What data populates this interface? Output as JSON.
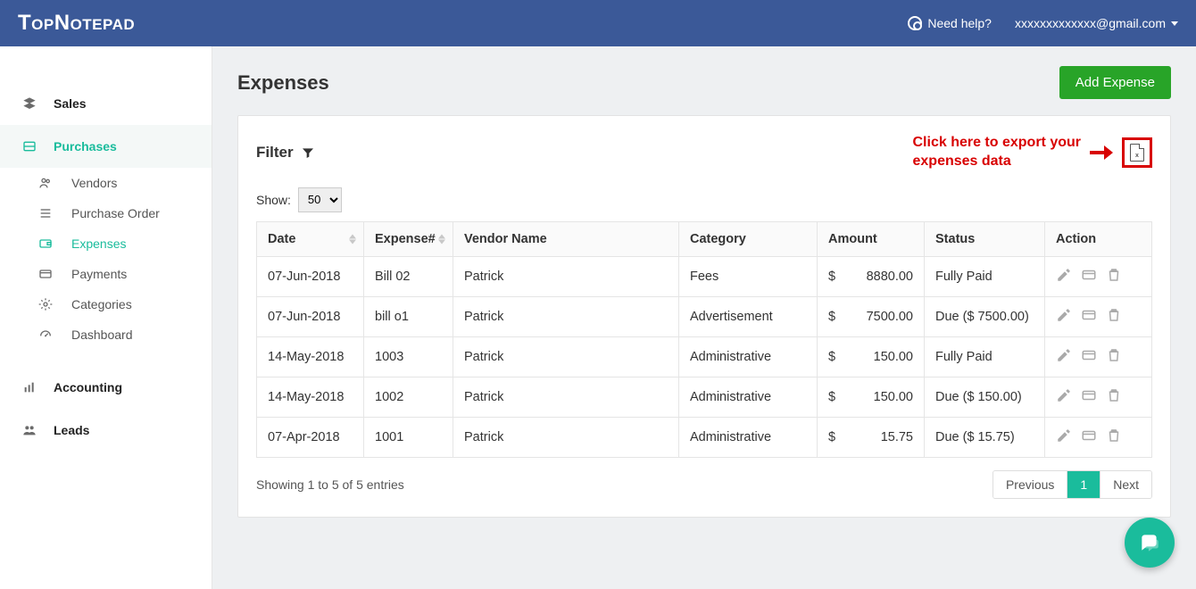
{
  "brand": "TopNotepad",
  "header": {
    "help_label": "Need help?",
    "user_email": "xxxxxxxxxxxxx@gmail.com"
  },
  "sidebar": {
    "sections": [
      {
        "label": "Sales",
        "icon": "layers-icon"
      },
      {
        "label": "Purchases",
        "icon": "folder-icon",
        "active": true
      },
      {
        "label": "Accounting",
        "icon": "chart-icon"
      },
      {
        "label": "Leads",
        "icon": "group-icon"
      }
    ],
    "purchases_sub": [
      {
        "label": "Vendors",
        "icon": "users-icon"
      },
      {
        "label": "Purchase Order",
        "icon": "list-icon"
      },
      {
        "label": "Expenses",
        "icon": "wallet-icon",
        "active": true
      },
      {
        "label": "Payments",
        "icon": "card-icon"
      },
      {
        "label": "Categories",
        "icon": "gear-icon"
      },
      {
        "label": "Dashboard",
        "icon": "gauge-icon"
      }
    ]
  },
  "page": {
    "title": "Expenses",
    "add_button": "Add Expense",
    "filter_label": "Filter",
    "callout_line1": "Click here to export your",
    "callout_line2": "expenses data",
    "show_label": "Show:",
    "show_value": "50",
    "table": {
      "headers": [
        "Date",
        "Expense#",
        "Vendor Name",
        "Category",
        "Amount",
        "Status",
        "Action"
      ],
      "rows": [
        {
          "date": "07-Jun-2018",
          "num": "Bill 02",
          "vendor": "Patrick",
          "category": "Fees",
          "cur": "$",
          "amount": "8880.00",
          "status": "Fully Paid"
        },
        {
          "date": "07-Jun-2018",
          "num": "bill o1",
          "vendor": "Patrick",
          "category": "Advertisement",
          "cur": "$",
          "amount": "7500.00",
          "status": "Due ($ 7500.00)"
        },
        {
          "date": "14-May-2018",
          "num": "1003",
          "vendor": "Patrick",
          "category": "Administrative",
          "cur": "$",
          "amount": "150.00",
          "status": "Fully Paid"
        },
        {
          "date": "14-May-2018",
          "num": "1002",
          "vendor": "Patrick",
          "category": "Administrative",
          "cur": "$",
          "amount": "150.00",
          "status": "Due ($ 150.00)"
        },
        {
          "date": "07-Apr-2018",
          "num": "1001",
          "vendor": "Patrick",
          "category": "Administrative",
          "cur": "$",
          "amount": "15.75",
          "status": "Due ($ 15.75)"
        }
      ]
    },
    "entries_text": "Showing 1 to 5 of 5 entries",
    "pager": {
      "prev": "Previous",
      "current": "1",
      "next": "Next"
    }
  }
}
